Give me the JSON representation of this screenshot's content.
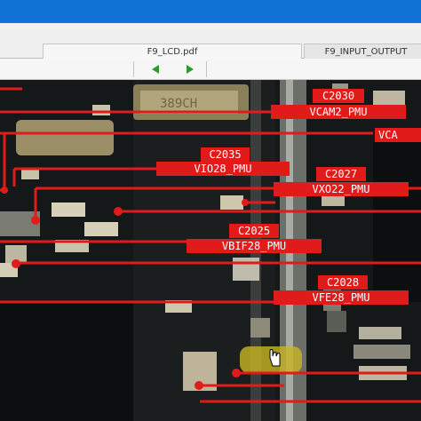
{
  "tabs": [
    {
      "label": "F9_LCD.pdf"
    },
    {
      "label": "F9_INPUT_OUTPUT"
    }
  ],
  "toolbar": {
    "back_icon": "back-arrow-icon",
    "forward_icon": "forward-arrow-icon",
    "arrow_color": "#2e9a2e"
  },
  "document": {
    "chip_marking": "389CH",
    "labels": [
      {
        "ref": "C2030",
        "net": "VCAM2_PMU"
      },
      {
        "ref": "",
        "net": "VCA"
      },
      {
        "ref": "C2035",
        "net": "VIO28_PMU"
      },
      {
        "ref": "C2027",
        "net": "VXO22_PMU"
      },
      {
        "ref": "C2025",
        "net": "VBIF28_PMU"
      },
      {
        "ref": "C2028",
        "net": "VFE28_PMU"
      }
    ],
    "annotation_color": "#e11a1a"
  }
}
